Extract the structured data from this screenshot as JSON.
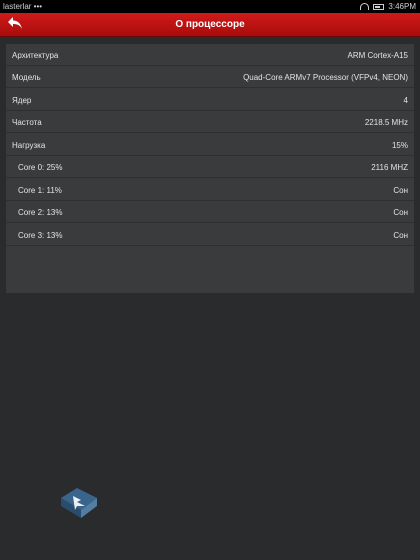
{
  "status": {
    "left_text": "lasterlar •••",
    "time": "3:46PM"
  },
  "header": {
    "title": "О процессоре",
    "back_icon": "back-arrow-icon"
  },
  "rows": [
    {
      "label": "Архитектура",
      "value": "ARM Cortex-A15"
    },
    {
      "label": "Модель",
      "value": "Quad-Core ARMv7 Processor (VFPv4, NEON)"
    },
    {
      "label": "Ядер",
      "value": "4"
    },
    {
      "label": "Частота",
      "value": "2218.5 MHz"
    },
    {
      "label": "Нагрузка",
      "value": "15%"
    }
  ],
  "cores": [
    {
      "label": "Core 0: 25%",
      "value": "2116 MHZ"
    },
    {
      "label": "Core 1: 11%",
      "value": "Сон"
    },
    {
      "label": "Core 2: 13%",
      "value": "Сон"
    },
    {
      "label": "Core 3: 13%",
      "value": "Сон"
    }
  ],
  "colors": {
    "header": "#c41414",
    "panel": "#3a3b3d",
    "background": "#2a2b2d"
  }
}
